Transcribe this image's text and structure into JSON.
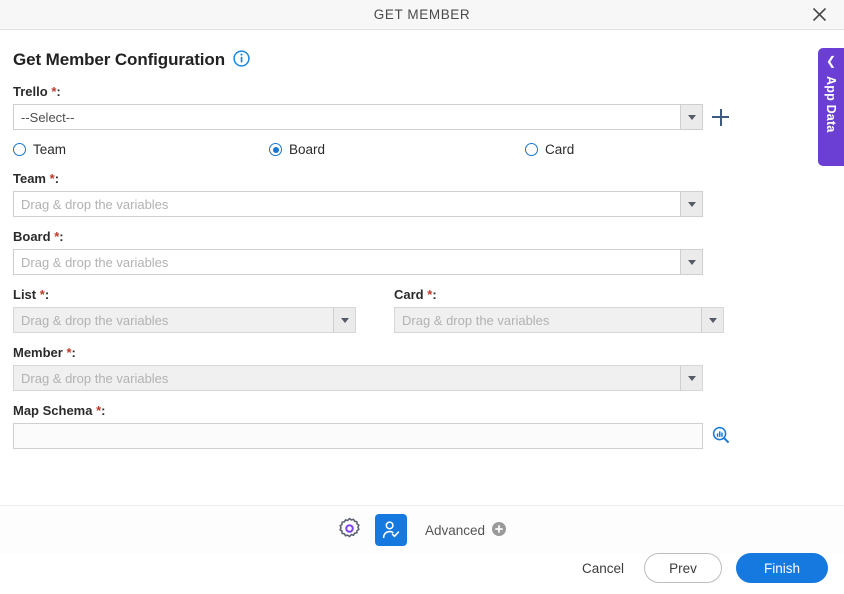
{
  "window": {
    "title": "GET MEMBER",
    "close_icon": "close-icon"
  },
  "header": {
    "title": "Get Member Configuration",
    "info_icon": "info-icon"
  },
  "form": {
    "trello": {
      "label": "Trello",
      "required": "*",
      "value": "--Select--",
      "add_icon": "plus-icon"
    },
    "scope_options": [
      {
        "label": "Team",
        "selected": false
      },
      {
        "label": "Board",
        "selected": true
      },
      {
        "label": "Card",
        "selected": false
      }
    ],
    "team": {
      "label": "Team",
      "required": "*",
      "placeholder": "Drag & drop the variables",
      "value": ""
    },
    "board": {
      "label": "Board",
      "required": "*",
      "placeholder": "Drag & drop the variables",
      "value": ""
    },
    "list": {
      "label": "List",
      "required": "*",
      "placeholder": "Drag & drop the variables",
      "value": ""
    },
    "card": {
      "label": "Card",
      "required": "*",
      "placeholder": "Drag & drop the variables",
      "value": ""
    },
    "member": {
      "label": "Member",
      "required": "*",
      "placeholder": "Drag & drop the variables",
      "value": ""
    },
    "map_schema": {
      "label": "Map Schema",
      "required": "*",
      "value": "",
      "browse_icon": "schema-search-icon"
    }
  },
  "toolbar": {
    "settings_icon": "gear-icon",
    "member_icon": "user-check-icon",
    "advanced_label": "Advanced",
    "advanced_add_icon": "plus-circle-icon"
  },
  "actions": {
    "cancel_label": "Cancel",
    "prev_label": "Prev",
    "finish_label": "Finish"
  },
  "app_data": {
    "label": "App Data",
    "chevron_icon": "chevron-left-icon"
  },
  "colors": {
    "accent_blue": "#1579e0",
    "purple": "#6b3fd4",
    "required_red": "#c0392b"
  }
}
